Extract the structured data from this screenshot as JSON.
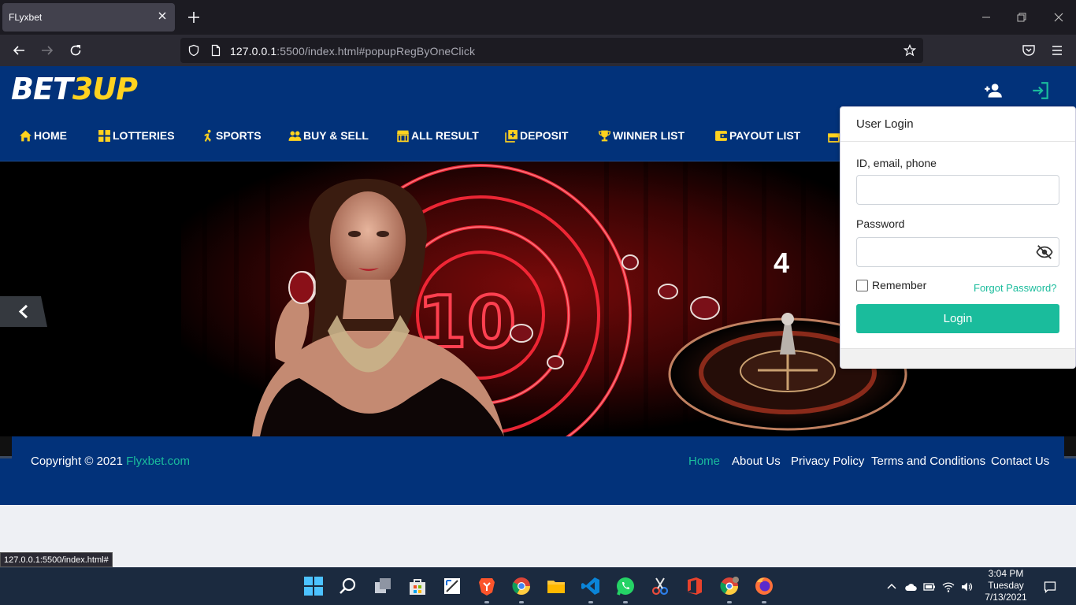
{
  "browser": {
    "tab_title": "FLyxbet",
    "url_host": "127.0.0.1",
    "url_rest": ":5500/index.html#popupRegByOneClick",
    "status_url": "127.0.0.1:5500/index.html#"
  },
  "site": {
    "logo_main": "BET",
    "logo_accent": "3UP",
    "accent_color": "#ffd21f",
    "brand_color": "#02327a",
    "menu": [
      {
        "label": "HOME",
        "icon": "home-icon"
      },
      {
        "label": "LOTTERIES",
        "icon": "grid-icon"
      },
      {
        "label": "SPORTS",
        "icon": "runner-icon"
      },
      {
        "label": "BUY & SELL",
        "icon": "people-icon"
      },
      {
        "label": "ALL RESULT",
        "icon": "store-icon"
      },
      {
        "label": "DEPOSIT",
        "icon": "add-box-icon"
      },
      {
        "label": "WINNER LIST",
        "icon": "trophy-icon"
      },
      {
        "label": "PAYOUT LIST",
        "icon": "wallet-icon"
      }
    ]
  },
  "hero": {
    "slide_number": "4",
    "chip_text": "10"
  },
  "login": {
    "title": "User Login",
    "id_label": "ID, email, phone",
    "id_value": "",
    "password_label": "Password",
    "password_value": "",
    "remember_label": "Remember",
    "forgot_label": "Forgot Password?",
    "button_label": "Login",
    "accent_color": "#1abc9c"
  },
  "footer": {
    "copyright_prefix": "Copyright © 2021 ",
    "copyright_link": "Flyxbet.com",
    "links": [
      "Home",
      "About Us",
      "Privacy Policy",
      "Terms and Conditions",
      "Contact Us"
    ]
  },
  "taskbar": {
    "time": "3:04 PM",
    "day": "Tuesday",
    "date": "7/13/2021"
  }
}
